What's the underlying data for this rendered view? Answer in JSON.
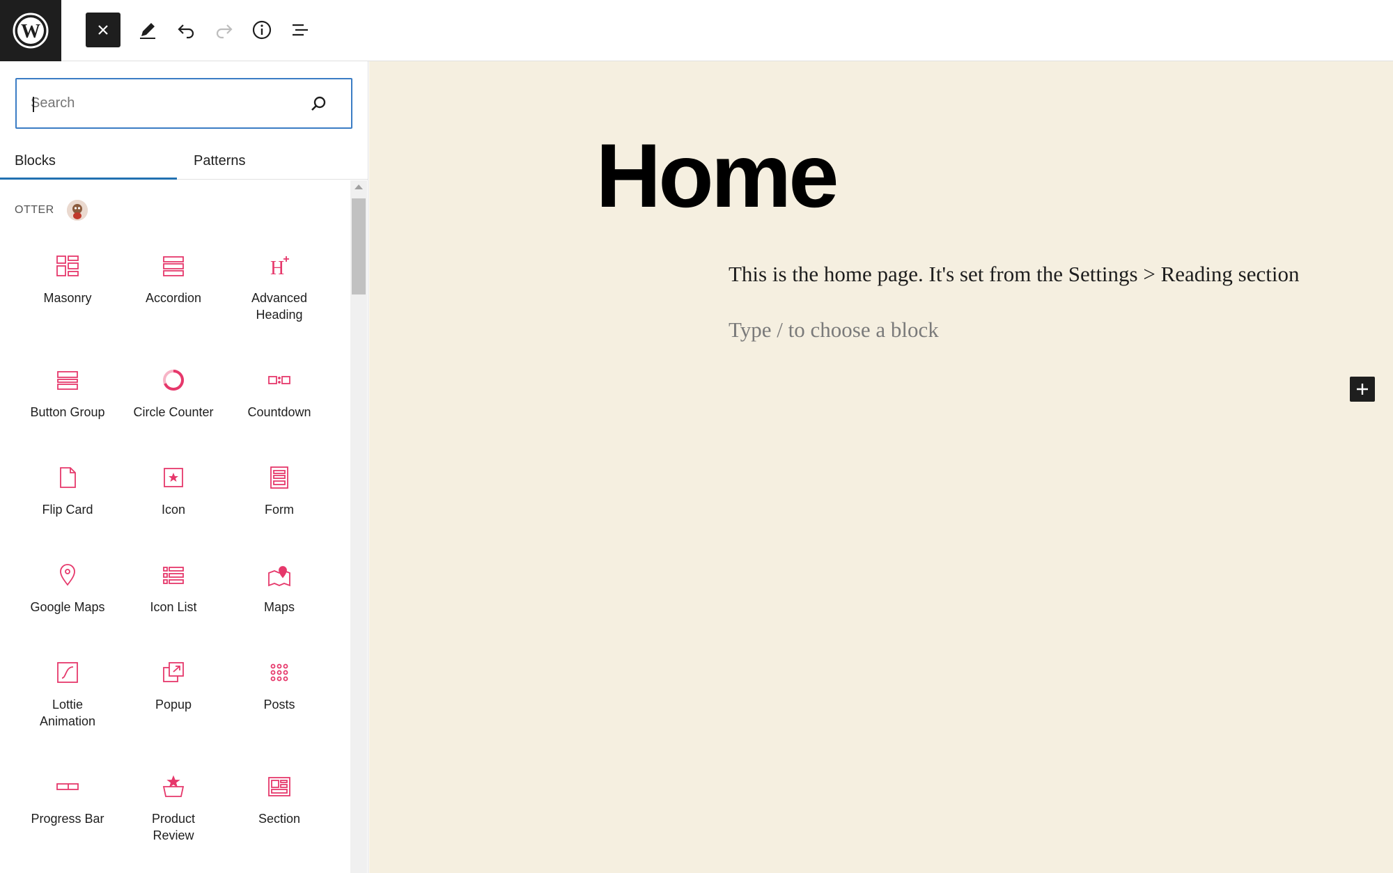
{
  "toolbar": {
    "logo_icon": "wordpress-logo-icon",
    "close_icon": "close-icon",
    "tools_icon": "pencil-icon",
    "undo_icon": "undo-icon",
    "redo_icon": "redo-icon",
    "details_icon": "info-icon",
    "list_view_icon": "list-view-icon"
  },
  "inserter": {
    "search": {
      "placeholder": "Search",
      "value": ""
    },
    "tabs": [
      {
        "label": "Blocks",
        "active": true
      },
      {
        "label": "Patterns",
        "active": false
      }
    ],
    "category": {
      "label": "OTTER",
      "icon": "otter-avatar-icon"
    },
    "blocks": [
      {
        "label": "Masonry",
        "icon": "masonry-icon"
      },
      {
        "label": "Accordion",
        "icon": "accordion-icon"
      },
      {
        "label": "Advanced\nHeading",
        "icon": "advanced-heading-icon"
      },
      {
        "label": "Button Group",
        "icon": "button-group-icon"
      },
      {
        "label": "Circle Counter",
        "icon": "circle-counter-icon"
      },
      {
        "label": "Countdown",
        "icon": "countdown-icon"
      },
      {
        "label": "Flip Card",
        "icon": "flip-card-icon"
      },
      {
        "label": "Icon",
        "icon": "icon-block-icon"
      },
      {
        "label": "Form",
        "icon": "form-icon"
      },
      {
        "label": "Google Maps",
        "icon": "google-maps-icon"
      },
      {
        "label": "Icon List",
        "icon": "icon-list-icon"
      },
      {
        "label": "Maps",
        "icon": "maps-icon"
      },
      {
        "label": "Lottie\nAnimation",
        "icon": "lottie-animation-icon"
      },
      {
        "label": "Popup",
        "icon": "popup-icon"
      },
      {
        "label": "Posts",
        "icon": "posts-icon"
      },
      {
        "label": "Progress Bar",
        "icon": "progress-bar-icon"
      },
      {
        "label": "Product\nReview",
        "icon": "product-review-icon"
      },
      {
        "label": "Section",
        "icon": "section-icon"
      }
    ]
  },
  "editor": {
    "title": "Home",
    "paragraph": "This is the home page. It's set from the Settings > Reading section",
    "placeholder": "Type / to choose a block",
    "add_block_icon": "plus-icon"
  },
  "colors": {
    "accent": "#2271b1",
    "otter_pink": "#e6386b",
    "canvas_bg": "#f5efe0",
    "toolbar_dark": "#1e1e1e"
  }
}
